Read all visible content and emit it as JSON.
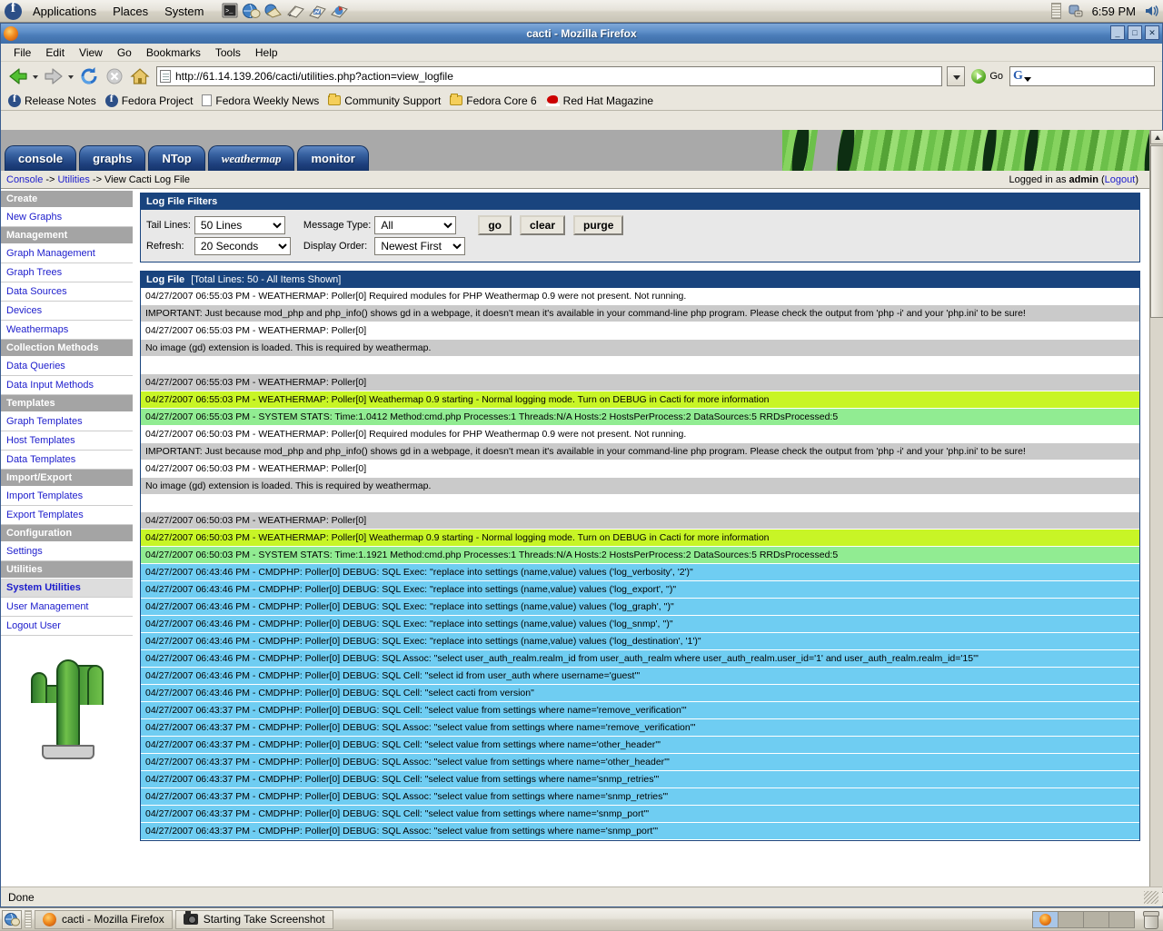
{
  "gnome_panel": {
    "menus": [
      "Applications",
      "Places",
      "System"
    ],
    "launchers": [
      "terminal-icon",
      "web-browser-icon",
      "email-icon",
      "writer-icon",
      "spreadsheet-icon",
      "presentation-icon"
    ],
    "clock": "6:59 PM",
    "tray": [
      "printer-icon",
      "volume-icon"
    ]
  },
  "window": {
    "title": "cacti - Mozilla Firefox",
    "buttons": {
      "minimize": "_",
      "maximize": "□",
      "close": "✕"
    }
  },
  "menubar": [
    "File",
    "Edit",
    "View",
    "Go",
    "Bookmarks",
    "Tools",
    "Help"
  ],
  "toolbar": {
    "back": "Back",
    "forward": "Forward",
    "reload": "Reload",
    "stop": "Stop",
    "home": "Home",
    "url": "http://61.14.139.206/cacti/utilities.php?action=view_logfile",
    "go_label": "Go",
    "search_placeholder": ""
  },
  "bookmarks": [
    {
      "label": "Release Notes",
      "icon": "fedora-icon"
    },
    {
      "label": "Fedora Project",
      "icon": "fedora-icon"
    },
    {
      "label": "Fedora Weekly News",
      "icon": "document-icon"
    },
    {
      "label": "Community Support",
      "icon": "folder-icon"
    },
    {
      "label": "Fedora Core 6",
      "icon": "folder-icon"
    },
    {
      "label": "Red Hat Magazine",
      "icon": "redhat-icon"
    }
  ],
  "cacti": {
    "tabs": [
      "console",
      "graphs",
      "NTop",
      "weathermap",
      "monitor"
    ],
    "breadcrumb": {
      "console": "Console",
      "sep1": "->",
      "utilities": "Utilities",
      "sep2": "->",
      "current": "View Cacti Log File"
    },
    "login": {
      "prefix": "Logged in as ",
      "user": "admin",
      "paren_open": " (",
      "logout": "Logout",
      "paren_close": ")"
    },
    "sidebar": [
      {
        "type": "head",
        "label": "Create"
      },
      {
        "type": "item",
        "label": "New Graphs",
        "active": false
      },
      {
        "type": "head",
        "label": "Management"
      },
      {
        "type": "item",
        "label": "Graph Management",
        "active": false
      },
      {
        "type": "item",
        "label": "Graph Trees",
        "active": false
      },
      {
        "type": "item",
        "label": "Data Sources",
        "active": false
      },
      {
        "type": "item",
        "label": "Devices",
        "active": false
      },
      {
        "type": "item",
        "label": "Weathermaps",
        "active": false
      },
      {
        "type": "head",
        "label": "Collection Methods"
      },
      {
        "type": "item",
        "label": "Data Queries",
        "active": false
      },
      {
        "type": "item",
        "label": "Data Input Methods",
        "active": false
      },
      {
        "type": "head",
        "label": "Templates"
      },
      {
        "type": "item",
        "label": "Graph Templates",
        "active": false
      },
      {
        "type": "item",
        "label": "Host Templates",
        "active": false
      },
      {
        "type": "item",
        "label": "Data Templates",
        "active": false
      },
      {
        "type": "head",
        "label": "Import/Export"
      },
      {
        "type": "item",
        "label": "Import Templates",
        "active": false
      },
      {
        "type": "item",
        "label": "Export Templates",
        "active": false
      },
      {
        "type": "head",
        "label": "Configuration"
      },
      {
        "type": "item",
        "label": "Settings",
        "active": false
      },
      {
        "type": "head",
        "label": "Utilities"
      },
      {
        "type": "item",
        "label": "System Utilities",
        "active": true
      },
      {
        "type": "item",
        "label": "User Management",
        "active": false
      },
      {
        "type": "item",
        "label": "Logout User",
        "active": false
      }
    ],
    "filters": {
      "title": "Log File Filters",
      "tail_lines_label": "Tail Lines:",
      "tail_lines_value": "50 Lines",
      "tail_lines_options": [
        "50 Lines"
      ],
      "message_type_label": "Message Type:",
      "message_type_value": "All",
      "message_type_options": [
        "All"
      ],
      "refresh_label": "Refresh:",
      "refresh_value": "20 Seconds",
      "refresh_options": [
        "20 Seconds"
      ],
      "display_order_label": "Display Order:",
      "display_order_value": "Newest First",
      "display_order_options": [
        "Newest First"
      ],
      "buttons": {
        "go": "go",
        "clear": "clear",
        "purge": "purge"
      }
    },
    "logfile": {
      "title": "Log File",
      "subtitle": "[Total Lines: 50 - All Items Shown]",
      "rows": [
        {
          "color": "white",
          "text": "04/27/2007 06:55:03 PM - WEATHERMAP: Poller[0] Required modules for PHP Weathermap 0.9 were not present. Not running."
        },
        {
          "color": "gray",
          "text": "IMPORTANT: Just because mod_php and php_info() shows gd in a webpage, it doesn't mean it's available in your command-line php program. Please check the output from 'php -i' and your 'php.ini' to be sure!"
        },
        {
          "color": "white",
          "text": "04/27/2007 06:55:03 PM - WEATHERMAP: Poller[0]"
        },
        {
          "color": "gray",
          "text": "No image (gd) extension is loaded. This is required by weathermap."
        },
        {
          "color": "white",
          "text": ""
        },
        {
          "color": "gray",
          "text": "04/27/2007 06:55:03 PM - WEATHERMAP: Poller[0]"
        },
        {
          "color": "lime",
          "text": "04/27/2007 06:55:03 PM - WEATHERMAP: Poller[0] Weathermap 0.9 starting - Normal logging mode. Turn on DEBUG in Cacti for more information"
        },
        {
          "color": "green",
          "text": "04/27/2007 06:55:03 PM - SYSTEM STATS: Time:1.0412 Method:cmd.php Processes:1 Threads:N/A Hosts:2 HostsPerProcess:2 DataSources:5 RRDsProcessed:5"
        },
        {
          "color": "white",
          "text": "04/27/2007 06:50:03 PM - WEATHERMAP: Poller[0] Required modules for PHP Weathermap 0.9 were not present. Not running."
        },
        {
          "color": "gray",
          "text": "IMPORTANT: Just because mod_php and php_info() shows gd in a webpage, it doesn't mean it's available in your command-line php program. Please check the output from 'php -i' and your 'php.ini' to be sure!"
        },
        {
          "color": "white",
          "text": "04/27/2007 06:50:03 PM - WEATHERMAP: Poller[0]"
        },
        {
          "color": "gray",
          "text": "No image (gd) extension is loaded. This is required by weathermap."
        },
        {
          "color": "white",
          "text": ""
        },
        {
          "color": "gray",
          "text": "04/27/2007 06:50:03 PM - WEATHERMAP: Poller[0]"
        },
        {
          "color": "lime",
          "text": "04/27/2007 06:50:03 PM - WEATHERMAP: Poller[0] Weathermap 0.9 starting - Normal logging mode. Turn on DEBUG in Cacti for more information"
        },
        {
          "color": "green",
          "text": "04/27/2007 06:50:03 PM - SYSTEM STATS: Time:1.1921 Method:cmd.php Processes:1 Threads:N/A Hosts:2 HostsPerProcess:2 DataSources:5 RRDsProcessed:5"
        },
        {
          "color": "blue",
          "text": "04/27/2007 06:43:46 PM - CMDPHP: Poller[0] DEBUG: SQL Exec: \"replace into settings (name,value) values ('log_verbosity', '2')\""
        },
        {
          "color": "blue",
          "text": "04/27/2007 06:43:46 PM - CMDPHP: Poller[0] DEBUG: SQL Exec: \"replace into settings (name,value) values ('log_export', '')\""
        },
        {
          "color": "blue",
          "text": "04/27/2007 06:43:46 PM - CMDPHP: Poller[0] DEBUG: SQL Exec: \"replace into settings (name,value) values ('log_graph', '')\""
        },
        {
          "color": "blue",
          "text": "04/27/2007 06:43:46 PM - CMDPHP: Poller[0] DEBUG: SQL Exec: \"replace into settings (name,value) values ('log_snmp', '')\""
        },
        {
          "color": "blue",
          "text": "04/27/2007 06:43:46 PM - CMDPHP: Poller[0] DEBUG: SQL Exec: \"replace into settings (name,value) values ('log_destination', '1')\""
        },
        {
          "color": "blue",
          "text": "04/27/2007 06:43:46 PM - CMDPHP: Poller[0] DEBUG: SQL Assoc: \"select user_auth_realm.realm_id from user_auth_realm where user_auth_realm.user_id='1' and user_auth_realm.realm_id='15'\""
        },
        {
          "color": "blue",
          "text": "04/27/2007 06:43:46 PM - CMDPHP: Poller[0] DEBUG: SQL Cell: \"select id from user_auth where username='guest'\""
        },
        {
          "color": "blue",
          "text": "04/27/2007 06:43:46 PM - CMDPHP: Poller[0] DEBUG: SQL Cell: \"select cacti from version\""
        },
        {
          "color": "blue",
          "text": "04/27/2007 06:43:37 PM - CMDPHP: Poller[0] DEBUG: SQL Cell: \"select value from settings where name='remove_verification'\""
        },
        {
          "color": "blue",
          "text": "04/27/2007 06:43:37 PM - CMDPHP: Poller[0] DEBUG: SQL Assoc: \"select value from settings where name='remove_verification'\""
        },
        {
          "color": "blue",
          "text": "04/27/2007 06:43:37 PM - CMDPHP: Poller[0] DEBUG: SQL Cell: \"select value from settings where name='other_header'\""
        },
        {
          "color": "blue",
          "text": "04/27/2007 06:43:37 PM - CMDPHP: Poller[0] DEBUG: SQL Assoc: \"select value from settings where name='other_header'\""
        },
        {
          "color": "blue",
          "text": "04/27/2007 06:43:37 PM - CMDPHP: Poller[0] DEBUG: SQL Cell: \"select value from settings where name='snmp_retries'\""
        },
        {
          "color": "blue",
          "text": "04/27/2007 06:43:37 PM - CMDPHP: Poller[0] DEBUG: SQL Assoc: \"select value from settings where name='snmp_retries'\""
        },
        {
          "color": "blue",
          "text": "04/27/2007 06:43:37 PM - CMDPHP: Poller[0] DEBUG: SQL Cell: \"select value from settings where name='snmp_port'\""
        },
        {
          "color": "blue",
          "text": "04/27/2007 06:43:37 PM - CMDPHP: Poller[0] DEBUG: SQL Assoc: \"select value from settings where name='snmp_port'\""
        }
      ]
    }
  },
  "statusbar": {
    "text": "Done"
  },
  "taskbar": {
    "tasks": [
      {
        "label": "cacti - Mozilla Firefox",
        "icon": "firefox-icon",
        "active": true
      },
      {
        "label": "Starting Take Screenshot",
        "icon": "camera-icon",
        "active": false
      }
    ],
    "workspaces": 4,
    "active_workspace": 1
  }
}
